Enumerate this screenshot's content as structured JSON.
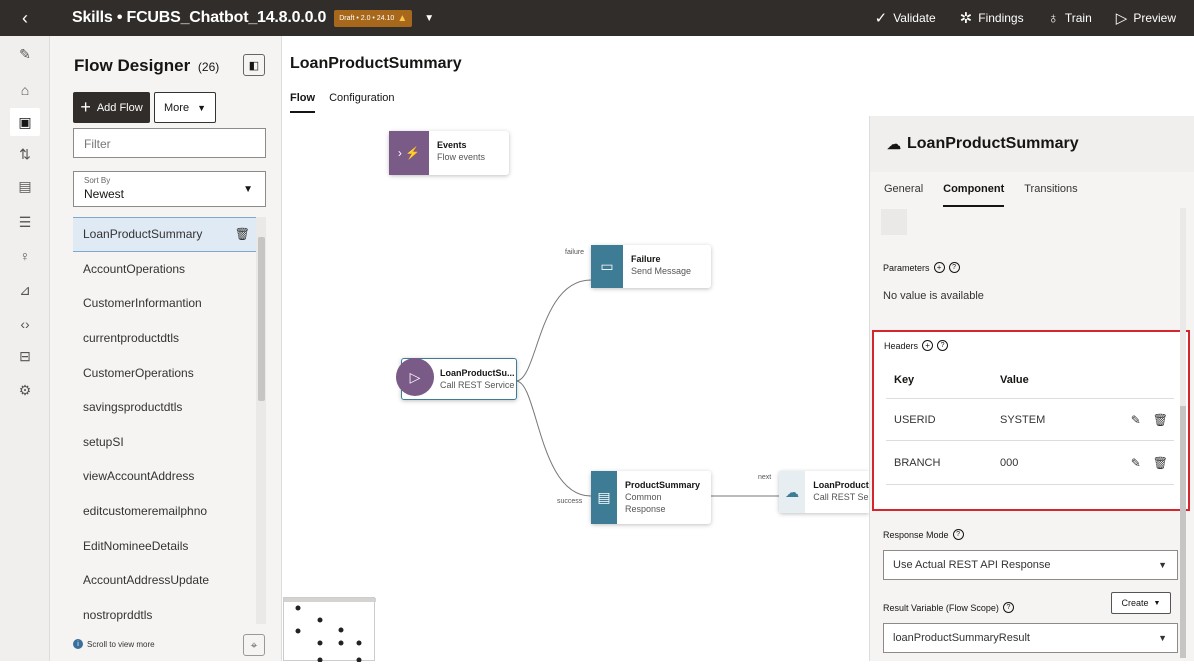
{
  "topbar": {
    "back_icon": "chevron-left",
    "title": "Skills • FCUBS_Chatbot_14.8.0.0.0",
    "draft_badge": "Draft • 2.0 • 24.10",
    "actions": [
      {
        "label": "Validate",
        "icon": "check"
      },
      {
        "label": "Findings",
        "icon": "bug"
      },
      {
        "label": "Train",
        "icon": "bulb"
      },
      {
        "label": "Preview",
        "icon": "play"
      }
    ]
  },
  "flow_designer": {
    "title": "Flow Designer",
    "count": "(26)",
    "add_flow": "Add Flow",
    "more": "More",
    "filter_placeholder": "Filter",
    "sort_label": "Sort By",
    "sort_value": "Newest",
    "flows": [
      "LoanProductSummary",
      "AccountOperations",
      "CustomerInformantion",
      "currentproductdtls",
      "CustomerOperations",
      "savingsproductdtls",
      "setupSI",
      "viewAccountAddress",
      "editcustomeremailphno",
      "EditNomineeDetails",
      "AccountAddressUpdate",
      "nostroprddtls"
    ],
    "scroll_hint": "Scroll to view more"
  },
  "page": {
    "title": "LoanProductSummary",
    "tabs": [
      "Flow",
      "Configuration"
    ]
  },
  "canvas": {
    "nodes": {
      "events": {
        "title": "Events",
        "sub": "Flow events"
      },
      "failure": {
        "title": "Failure",
        "sub": "Send Message"
      },
      "loan_start": {
        "title": "LoanProductSu...",
        "sub": "Call REST Service"
      },
      "product_summary": {
        "title": "ProductSummary",
        "sub1": "Common",
        "sub2": "Response"
      },
      "loan_next": {
        "title": "LoanProduct",
        "sub": "Call REST Ser"
      }
    },
    "edge_labels": {
      "failure": "failure",
      "success": "success",
      "next": "next"
    }
  },
  "properties": {
    "title": "LoanProductSummary",
    "tabs": [
      "General",
      "Component",
      "Transitions"
    ],
    "parameters_label": "Parameters",
    "parameters_empty": "No value is available",
    "headers_label": "Headers",
    "headers_columns": [
      "Key",
      "Value"
    ],
    "headers": [
      {
        "key": "USERID",
        "value": "SYSTEM"
      },
      {
        "key": "BRANCH",
        "value": "000"
      }
    ],
    "response_mode_label": "Response Mode",
    "response_mode_value": "Use Actual REST API Response",
    "result_variable_label": "Result Variable (Flow Scope)",
    "create_label": "Create",
    "result_variable_value": "loanProductSummaryResult"
  },
  "colors": {
    "topbar": "#312d2a",
    "node_icon": "#3e7c96",
    "events_icon": "#7a5a86",
    "highlight": "#d4262c"
  }
}
